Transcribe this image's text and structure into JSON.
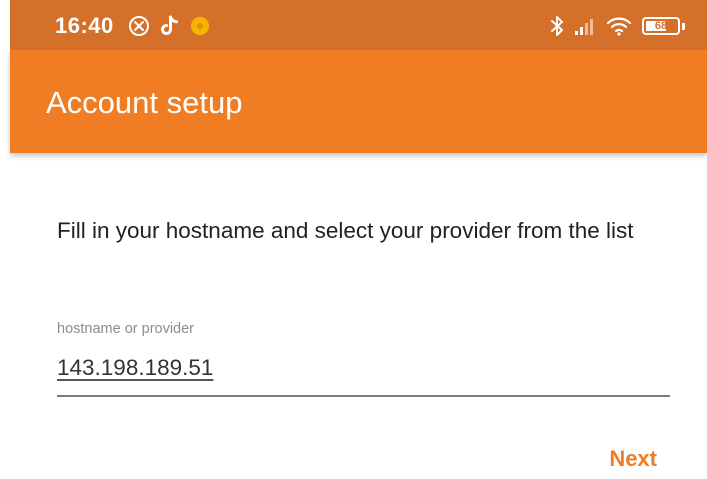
{
  "status_bar": {
    "time": "16:40",
    "left_icons": [
      "close-circle-icon",
      "tiktok-icon",
      "notification-dot-icon"
    ],
    "right_icons": [
      "bluetooth-icon",
      "cellular-signal-icon",
      "wifi-icon",
      "battery-icon"
    ],
    "battery_level": "68",
    "battery_fraction": 0.68
  },
  "app_bar": {
    "title": "Account setup"
  },
  "form": {
    "instruction": "Fill in your hostname and select your provider from the list",
    "field_label": "hostname or provider",
    "field_value": "143.198.189.51",
    "next_label": "Next"
  },
  "colors": {
    "status_bar": "#d5702a",
    "app_bar": "#f07d24",
    "accent": "#f07d24"
  }
}
